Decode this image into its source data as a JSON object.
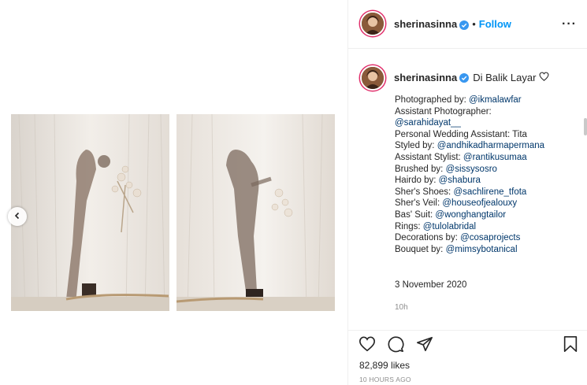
{
  "post": {
    "username": "sherinasinna",
    "follow_label": "Follow",
    "separator": "•",
    "more_label": "···",
    "caption_title": "Di Balik Layar",
    "caption_lines": [
      {
        "label": "Photographed by: ",
        "mention": "@ikmalawfar"
      },
      {
        "label": "Assistant Photographer:",
        "mention": ""
      },
      {
        "label": "",
        "mention": "@sarahidayat__"
      },
      {
        "label": "Personal Wedding Assistant: Tita",
        "mention": ""
      },
      {
        "label": "Styled by: ",
        "mention": "@andhikadharmapermana"
      },
      {
        "label": "Assistant Stylist: ",
        "mention": "@rantikusumaa"
      },
      {
        "label": "Brushed by: ",
        "mention": "@sissysosro"
      },
      {
        "label": "Hairdo by: ",
        "mention": "@shabura"
      },
      {
        "label": "Sher's Shoes: ",
        "mention": "@sachlirene_tfota"
      },
      {
        "label": "Sher's Veil: ",
        "mention": "@houseofjealouxy"
      },
      {
        "label": "Bas' Suit: ",
        "mention": "@wonghangtailor"
      },
      {
        "label": "Rings: ",
        "mention": "@tulolabridal"
      },
      {
        "label": "Decorations by: ",
        "mention": "@cosaprojects"
      },
      {
        "label": "Bouquet by: ",
        "mention": "@mimsybotanical"
      }
    ],
    "caption_date": "3 November 2020",
    "caption_time": "10h",
    "likes": "82,899 likes",
    "posted_ago": "10 HOURS AGO"
  },
  "colors": {
    "accent": "#0095f6",
    "mention": "#00376b",
    "text": "#262626",
    "muted": "#8e8e8e",
    "verified": "#3897f0"
  },
  "icons": [
    "verified-badge-icon",
    "heart-icon",
    "comment-icon",
    "share-icon",
    "bookmark-icon",
    "chevron-left-icon",
    "more-icon"
  ]
}
